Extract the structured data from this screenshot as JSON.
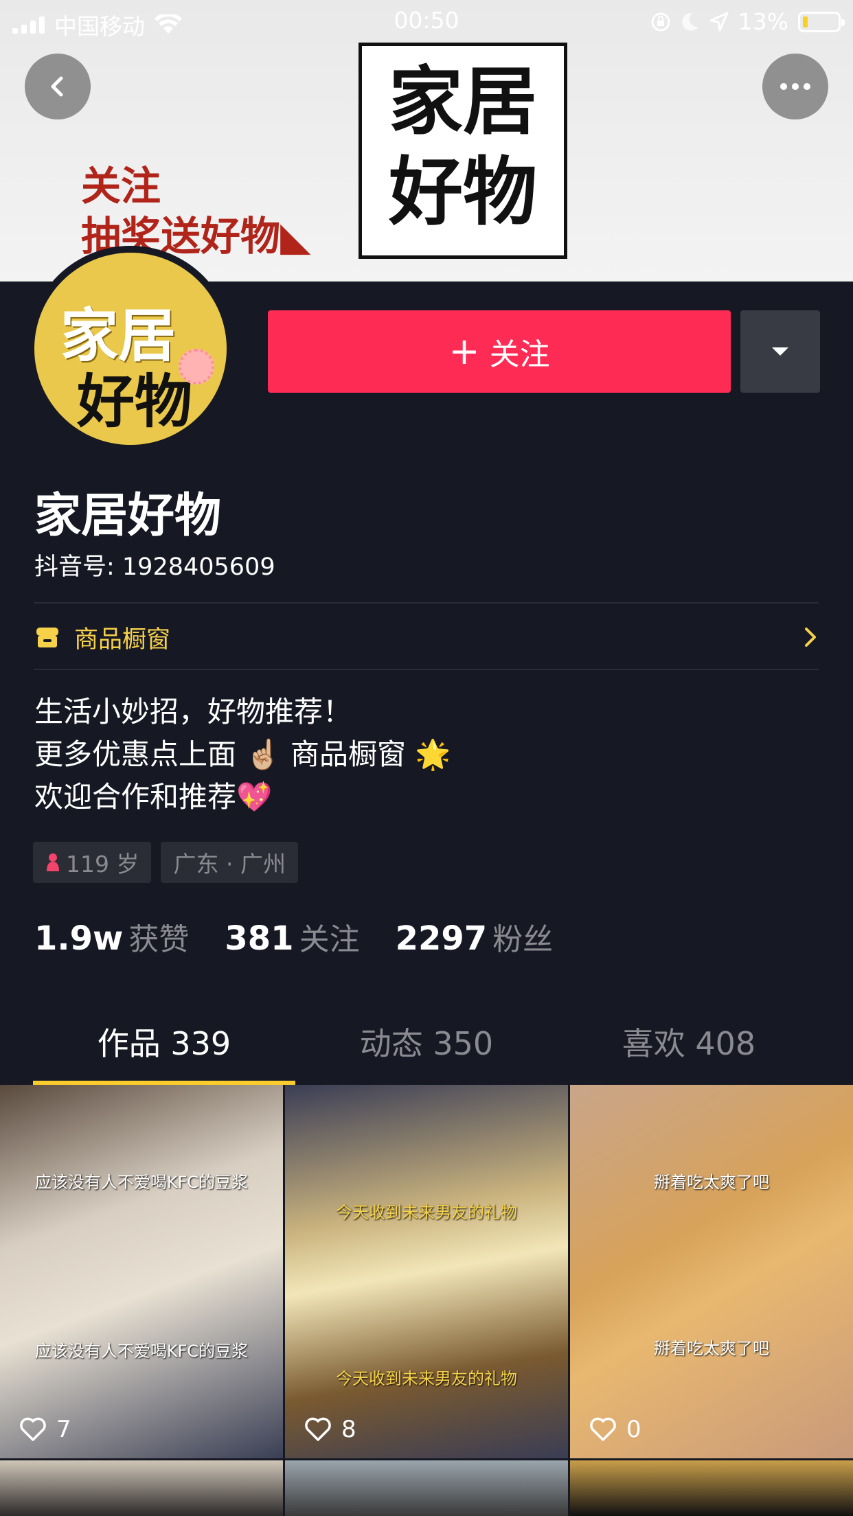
{
  "status_bar": {
    "carrier": "中国移动",
    "time": "00:50",
    "battery": "13%",
    "battery_level": 0.13
  },
  "banner": {
    "box_line1": "家居",
    "box_line2": "好物",
    "promo_line1": "关注",
    "promo_line2": "抽奖送好物◣"
  },
  "avatar": {
    "line1": "家居",
    "line2": "好物"
  },
  "actions": {
    "follow_label": "关注",
    "follow_prefix": "+"
  },
  "profile": {
    "nickname": "家居好物",
    "douyin_id": "抖音号: 1928405609",
    "shop_label": "商品橱窗",
    "bio": [
      "生活小妙招，好物推荐！",
      "更多优惠点上面 ☝🏼 商品橱窗 🌟",
      "欢迎合作和推荐💖"
    ],
    "tags": [
      "119 岁",
      "广东 · 广州"
    ]
  },
  "stats": [
    {
      "num": "1.9w",
      "label": "获赞"
    },
    {
      "num": "381",
      "label": "关注"
    },
    {
      "num": "2297",
      "label": "粉丝"
    }
  ],
  "tabs": [
    {
      "label": "作品 339"
    },
    {
      "label": "动态 350"
    },
    {
      "label": "喜欢 408"
    }
  ],
  "videos": [
    {
      "caption_top": "应该没有人不爱喝KFC的豆浆",
      "caption_mid": "应该没有人不爱喝KFC的豆浆",
      "likes": "7"
    },
    {
      "caption_top": "今天收到未来男友的礼物",
      "caption_mid": "今天收到未来男友的礼物",
      "likes": "8"
    },
    {
      "caption_top": "掰着吃太爽了吧",
      "caption_mid": "掰着吃太爽了吧",
      "likes": "0"
    }
  ],
  "colors": {
    "background": "#161823",
    "follow": "#fe2c55",
    "accent": "#facc2e"
  }
}
